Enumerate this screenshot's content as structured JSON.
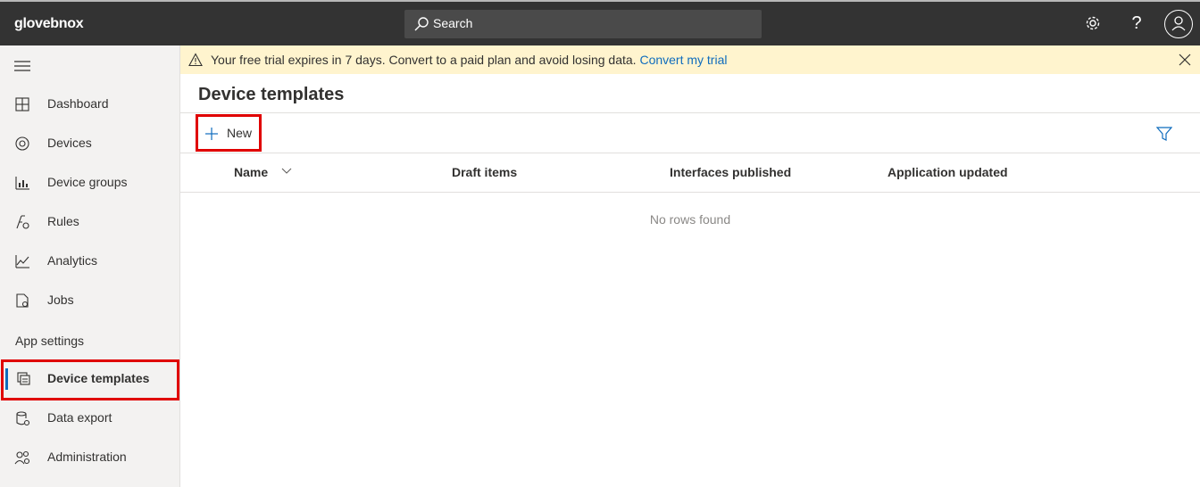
{
  "app": {
    "brand": "glovebnox"
  },
  "topbar": {
    "search_label": "Search",
    "icons": [
      "search-icon",
      "gear-icon",
      "help-icon",
      "avatar-icon"
    ],
    "help_glyph": "?"
  },
  "sidebar": {
    "items": [
      {
        "label": "Dashboard",
        "icon": "dashboard-icon"
      },
      {
        "label": "Devices",
        "icon": "devices-icon"
      },
      {
        "label": "Device groups",
        "icon": "device-groups-icon"
      },
      {
        "label": "Rules",
        "icon": "rules-icon"
      },
      {
        "label": "Analytics",
        "icon": "analytics-icon"
      },
      {
        "label": "Jobs",
        "icon": "jobs-icon"
      }
    ],
    "section_label": "App settings",
    "settings_items": [
      {
        "label": "Device templates",
        "icon": "device-templates-icon",
        "active": true
      },
      {
        "label": "Data export",
        "icon": "data-export-icon"
      },
      {
        "label": "Administration",
        "icon": "administration-icon"
      }
    ]
  },
  "banner": {
    "message": "Your free trial expires in 7 days. Convert to a paid plan and avoid losing data.",
    "link": "Convert my trial"
  },
  "main": {
    "title": "Device templates",
    "toolbar": {
      "new_label": "New"
    },
    "columns": [
      "Name",
      "Draft items",
      "Interfaces published",
      "Application updated"
    ],
    "empty_text": "No rows found"
  },
  "colors": {
    "topbar": "#333333",
    "accent": "#0f6cbd",
    "banner": "#fff4ce",
    "highlight": "#e00000"
  }
}
